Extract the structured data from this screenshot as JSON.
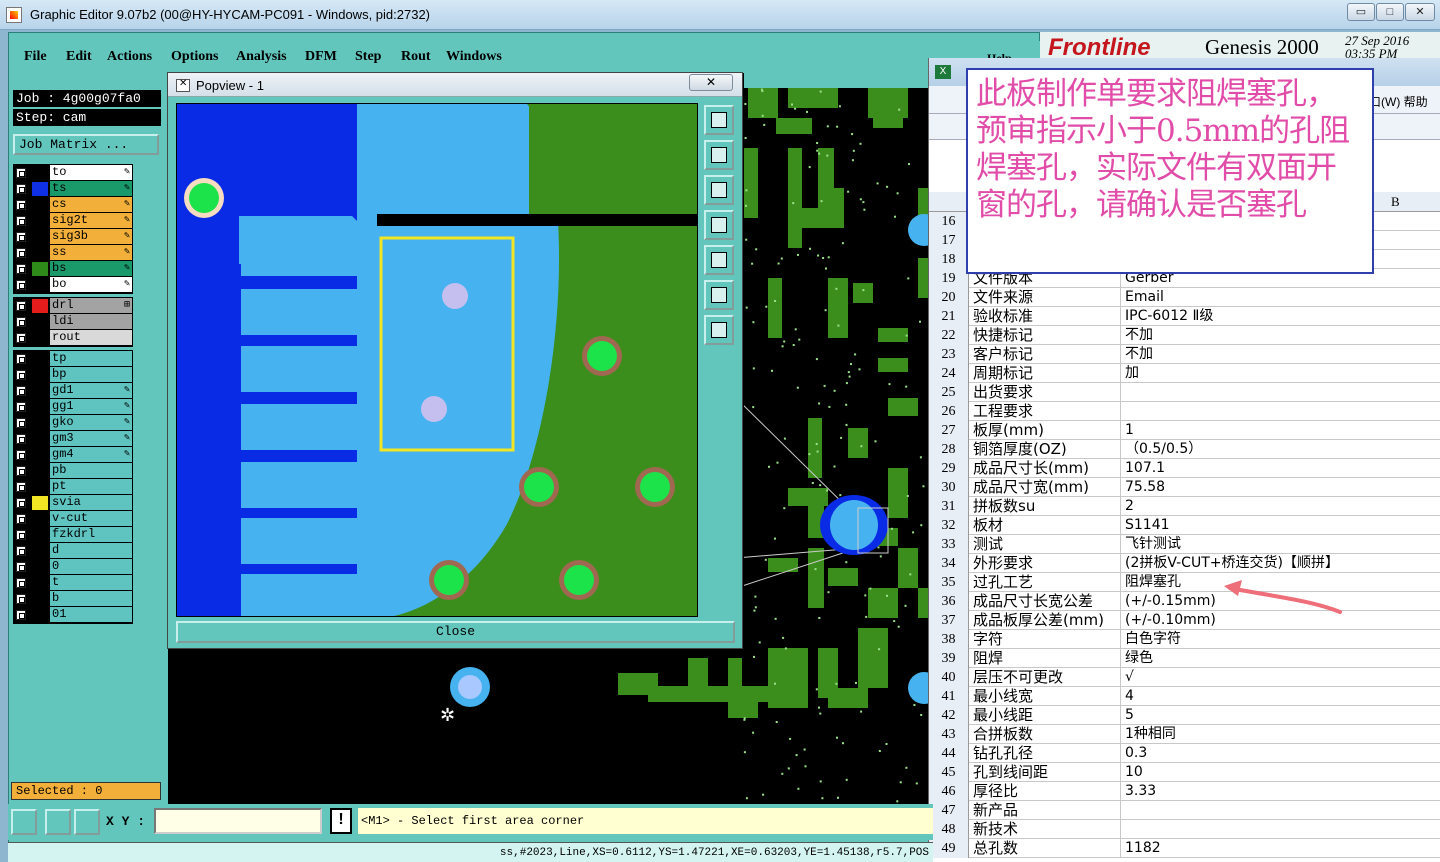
{
  "window": {
    "title": "Graphic Editor 9.07b2 (00@HY-HYCAM-PC091 - Windows, pid:2732)",
    "min": "▭",
    "max": "□",
    "close": "✕"
  },
  "menu": [
    "File",
    "Edit",
    "Actions",
    "Options",
    "Analysis",
    "DFM",
    "Step",
    "Rout",
    "Windows"
  ],
  "help": "Help",
  "brand": {
    "logo": "Frontline",
    "product": "Genesis 2000",
    "date": "27 Sep 2016",
    "time": "03:35 PM"
  },
  "job": {
    "job_line": "Job : 4g00g07fa0",
    "step_line": "Step: cam",
    "matrix_btn": "Job Matrix ..."
  },
  "layers_top": [
    {
      "name": "to",
      "color": "#ffffff",
      "swatch": "#000000",
      "mark": "✎"
    },
    {
      "name": "ts",
      "color": "#1a9a6b",
      "swatch": "#1030e6",
      "mark": "✎"
    },
    {
      "name": "cs",
      "color": "#f2b03a",
      "swatch": "#000000",
      "mark": "✎"
    },
    {
      "name": "sig2t",
      "color": "#f2b03a",
      "swatch": "#000000",
      "mark": "✎"
    },
    {
      "name": "sig3b",
      "color": "#f2b03a",
      "swatch": "#000000",
      "mark": "✎"
    },
    {
      "name": "ss",
      "color": "#f2b03a",
      "swatch": "#000000",
      "mark": "✎"
    },
    {
      "name": "bs",
      "color": "#1a9a6b",
      "swatch": "#2e8b1a",
      "mark": "✎"
    },
    {
      "name": "bo",
      "color": "#ffffff",
      "swatch": "#000000",
      "mark": "✎"
    }
  ],
  "layers_drill": [
    {
      "name": "drl",
      "color": "#a3a3a3",
      "swatch": "#e41c1c",
      "mark": "⊞"
    },
    {
      "name": "ldi",
      "color": "#a3a3a3",
      "swatch": "#000000",
      "mark": ""
    },
    {
      "name": "rout",
      "color": "#d9d9d9",
      "swatch": "#000000",
      "mark": ""
    }
  ],
  "layers_misc": [
    {
      "name": "tp",
      "color": "#5fc4c0",
      "swatch": "#000000",
      "mark": ""
    },
    {
      "name": "bp",
      "color": "#5fc4c0",
      "swatch": "#000000",
      "mark": ""
    },
    {
      "name": "gd1",
      "color": "#5fc4c0",
      "swatch": "#000000",
      "mark": "✎"
    },
    {
      "name": "gg1",
      "color": "#5fc4c0",
      "swatch": "#000000",
      "mark": "✎"
    },
    {
      "name": "gko",
      "color": "#5fc4c0",
      "swatch": "#000000",
      "mark": "✎"
    },
    {
      "name": "gm3",
      "color": "#5fc4c0",
      "swatch": "#000000",
      "mark": "✎"
    },
    {
      "name": "gm4",
      "color": "#5fc4c0",
      "swatch": "#000000",
      "mark": "✎"
    },
    {
      "name": "pb",
      "color": "#5fc4c0",
      "swatch": "#000000",
      "mark": ""
    },
    {
      "name": "pt",
      "color": "#5fc4c0",
      "swatch": "#000000",
      "mark": ""
    },
    {
      "name": "svia",
      "color": "#5fc4c0",
      "swatch": "#f2e524",
      "mark": ""
    },
    {
      "name": "v-cut",
      "color": "#5fc4c0",
      "swatch": "#000000",
      "mark": ""
    },
    {
      "name": "fzkdrl",
      "color": "#5fc4c0",
      "swatch": "#000000",
      "mark": ""
    },
    {
      "name": "d",
      "color": "#5fc4c0",
      "swatch": "#000000",
      "mark": ""
    },
    {
      "name": "0",
      "color": "#5fc4c0",
      "swatch": "#000000",
      "mark": ""
    },
    {
      "name": "t",
      "color": "#5fc4c0",
      "swatch": "#000000",
      "mark": ""
    },
    {
      "name": "b",
      "color": "#5fc4c0",
      "swatch": "#000000",
      "mark": ""
    },
    {
      "name": "01",
      "color": "#5fc4c0",
      "swatch": "#000000",
      "mark": ""
    }
  ],
  "selected": "Selected : 0",
  "xy_label": "X Y :",
  "prompt": "<M1> - Select first area corner",
  "status": "ss,#2023,Line,XS=0.6112,YS=1.47221,XE=0.63203,YE=1.45138,r5.7,POS",
  "popview": {
    "title": "Popview - 1",
    "close_label": "Close"
  },
  "excel": {
    "col_b": "B",
    "menu_right": "口(W)  帮助",
    "rows": [
      {
        "n": "16",
        "a": "",
        "b": ""
      },
      {
        "n": "17",
        "a": "",
        "b": ""
      },
      {
        "n": "18",
        "a": "",
        "b": ""
      },
      {
        "n": "19",
        "a": "文件版本",
        "b": "Gerber"
      },
      {
        "n": "20",
        "a": "文件来源",
        "b": "Email"
      },
      {
        "n": "21",
        "a": "验收标准",
        "b": "IPC-6012 Ⅱ级"
      },
      {
        "n": "22",
        "a": "快捷标记",
        "b": "不加"
      },
      {
        "n": "23",
        "a": "客户标记",
        "b": "不加"
      },
      {
        "n": "24",
        "a": "周期标记",
        "b": "加"
      },
      {
        "n": "25",
        "a": "出货要求",
        "b": ""
      },
      {
        "n": "26",
        "a": "工程要求",
        "b": ""
      },
      {
        "n": "27",
        "a": "板厚(mm)",
        "b": "1"
      },
      {
        "n": "28",
        "a": "铜箔厚度(OZ)",
        "b": "（0.5/0.5）"
      },
      {
        "n": "29",
        "a": "成品尺寸长(mm)",
        "b": "107.1"
      },
      {
        "n": "30",
        "a": "成品尺寸宽(mm)",
        "b": "75.58"
      },
      {
        "n": "31",
        "a": "拼板数su",
        "b": "2"
      },
      {
        "n": "32",
        "a": "板材",
        "b": "S1141"
      },
      {
        "n": "33",
        "a": "测试",
        "b": "飞针测试"
      },
      {
        "n": "34",
        "a": "外形要求",
        "b": "(2拼板V-CUT+桥连交货)【顺拼】"
      },
      {
        "n": "35",
        "a": "过孔工艺",
        "b": "阻焊塞孔"
      },
      {
        "n": "36",
        "a": "成品尺寸长宽公差",
        "b": "(+/-0.15mm)"
      },
      {
        "n": "37",
        "a": "成品板厚公差(mm)",
        "b": "(+/-0.10mm)"
      },
      {
        "n": "38",
        "a": "字符",
        "b": "白色字符"
      },
      {
        "n": "39",
        "a": "阻焊",
        "b": "绿色"
      },
      {
        "n": "40",
        "a": "层压不可更改",
        "b": "√"
      },
      {
        "n": "41",
        "a": "最小线宽",
        "b": "4"
      },
      {
        "n": "42",
        "a": "最小线距",
        "b": "5"
      },
      {
        "n": "43",
        "a": "合拼板数",
        "b": "1种相同"
      },
      {
        "n": "44",
        "a": "钻孔孔径",
        "b": "0.3"
      },
      {
        "n": "45",
        "a": "孔到线间距",
        "b": "10"
      },
      {
        "n": "46",
        "a": "厚径比",
        "b": "3.33"
      },
      {
        "n": "47",
        "a": "新产品",
        "b": ""
      },
      {
        "n": "48",
        "a": "新技术",
        "b": ""
      },
      {
        "n": "49",
        "a": "总孔数",
        "b": "1182"
      }
    ]
  },
  "annotation": "此板制作单要求阻焊塞孔，预审指示小于0.5mm的孔阻焊塞孔，实际文件有双面开窗的孔，请确认是否塞孔",
  "colors": {
    "panel": "#63c6bd",
    "annotation_text": "#e24ca9",
    "annotation_border": "#2f3fae",
    "arrow": "#ee6f7a",
    "pcb_green": "#3c8e1c",
    "pcb_blue": "#46b3f0",
    "pcb_dark_blue": "#0a2be6",
    "highlight": "#f2e524"
  }
}
